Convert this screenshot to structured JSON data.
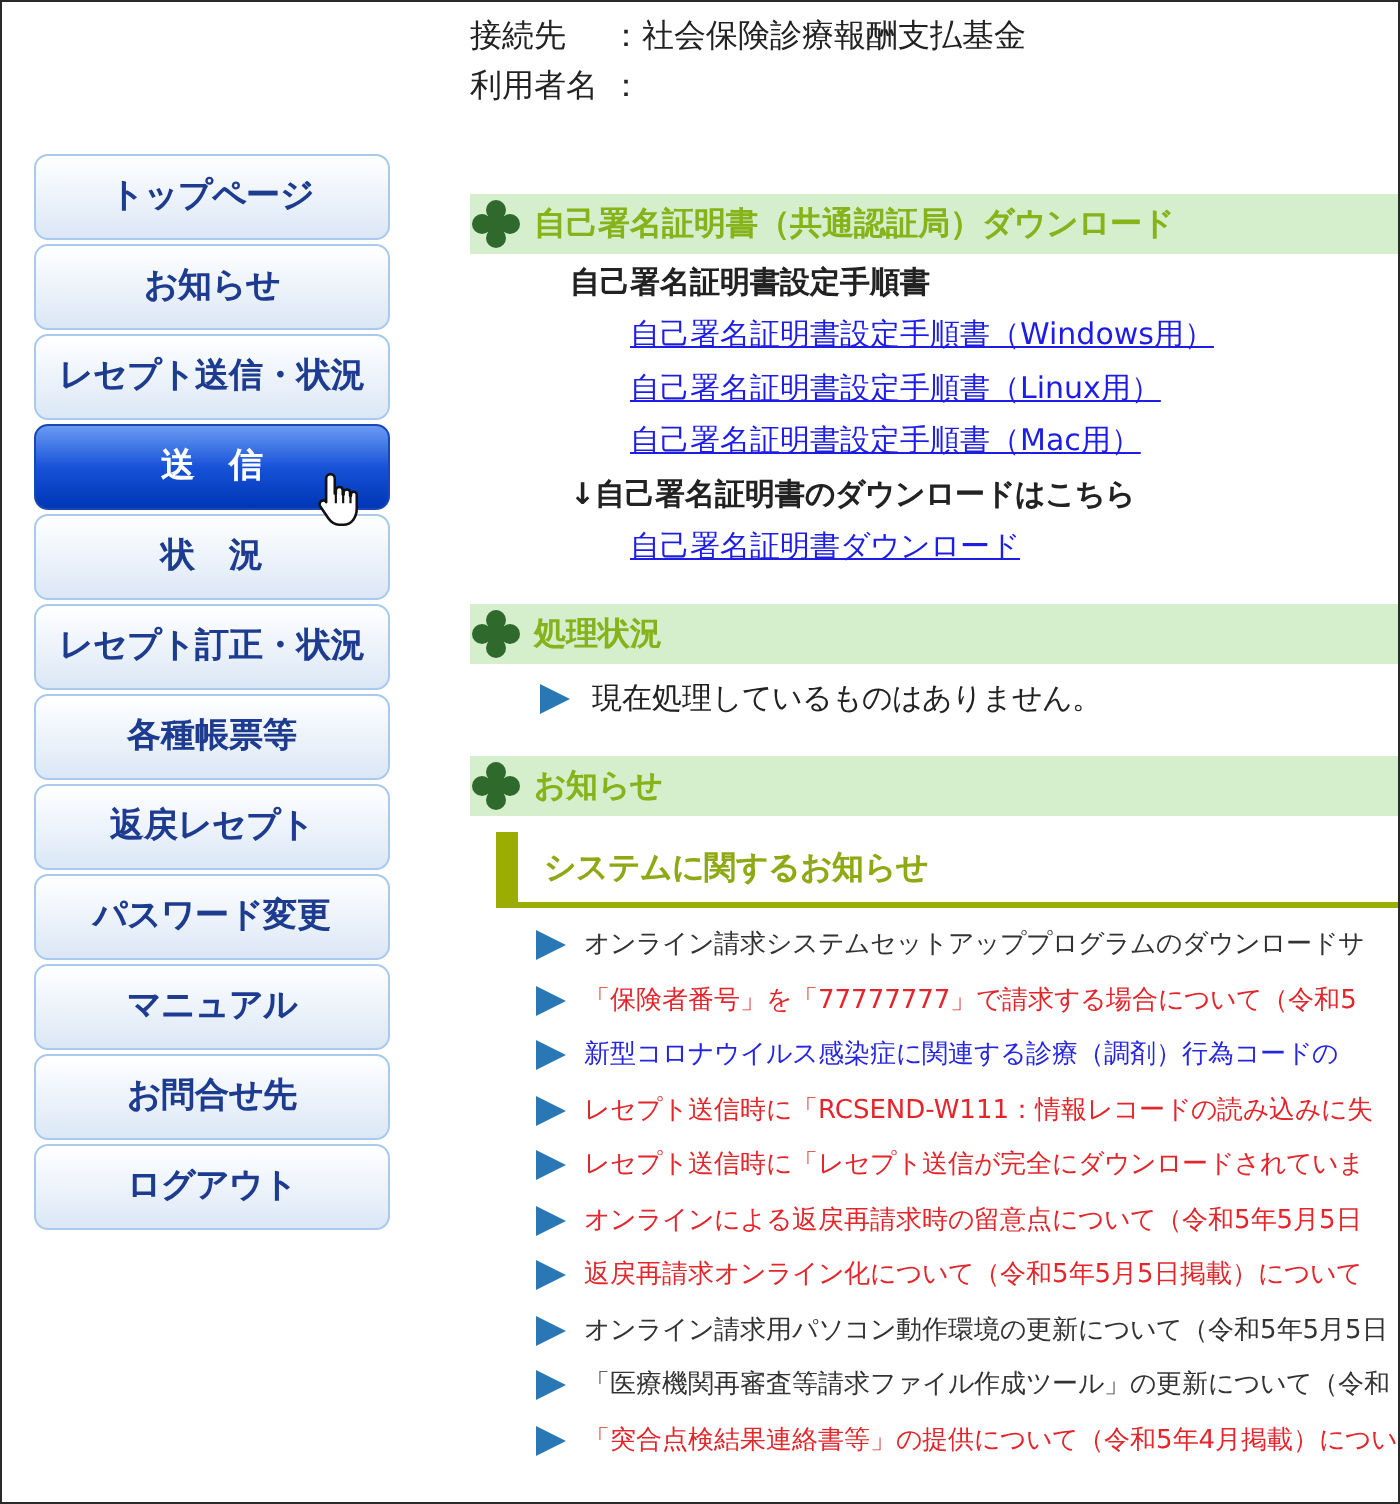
{
  "header": [
    {
      "label": "接続先",
      "colon": "：",
      "value": "社会保険診療報酬支払基金"
    },
    {
      "label": "利用者名",
      "colon": "："
    }
  ],
  "sidebar": {
    "items": [
      {
        "label": "トップページ",
        "selected": false
      },
      {
        "label": "お知らせ",
        "selected": false
      },
      {
        "label": "レセプト送信・状況",
        "selected": false
      },
      {
        "label": "送　信",
        "selected": true
      },
      {
        "label": "状　況",
        "selected": false
      },
      {
        "label": "レセプト訂正・状況",
        "selected": false
      },
      {
        "label": "各種帳票等",
        "selected": false
      },
      {
        "label": "返戻レセプト",
        "selected": false
      },
      {
        "label": "パスワード変更",
        "selected": false
      },
      {
        "label": "マニュアル",
        "selected": false
      },
      {
        "label": "お問合せ先",
        "selected": false
      },
      {
        "label": "ログアウト",
        "selected": false
      }
    ]
  },
  "sections": [
    {
      "kind": "downloads",
      "title": "自己署名証明書（共通認証局）ダウンロード",
      "groups": [
        {
          "heading": "自己署名証明書設定手順書",
          "links": [
            "自己署名証明書設定手順書（Windows用）",
            "自己署名証明書設定手順書（Linux用）",
            "自己署名証明書設定手順書（Mac用）"
          ]
        },
        {
          "heading": "↓自己署名証明書のダウンロードはこちら",
          "links": [
            "自己署名証明書ダウンロード"
          ]
        }
      ]
    },
    {
      "kind": "status",
      "title": "処理状況",
      "items": [
        "現在処理しているものはありません。"
      ]
    },
    {
      "kind": "notices",
      "title": "お知らせ",
      "subsections": [
        {
          "title": "システムに関するお知らせ",
          "items": [
            {
              "text": "オンライン請求システムセットアッププログラムのダウンロードサ",
              "color": "#333333"
            },
            {
              "text": "「保険者番号」を「77777777」で請求する場合について（令和5",
              "color": "#e3262b"
            },
            {
              "text": "新型コロナウイルス感染症に関連する診療（調剤）行為コードの",
              "color": "#2626e0"
            },
            {
              "text": "レセプト送信時に「RCSEND-W111：情報レコードの読み込みに失",
              "color": "#e3262b"
            },
            {
              "text": "レセプト送信時に「レセプト送信が完全にダウンロードされていま",
              "color": "#e3262b"
            },
            {
              "text": "オンラインによる返戻再請求時の留意点について（令和5年5月5日",
              "color": "#e3262b"
            },
            {
              "text": "返戻再請求オンライン化について（令和5年5月5日掲載）について",
              "color": "#e3262b"
            },
            {
              "text": "オンライン請求用パソコン動作環境の更新について（令和5年5月5日",
              "color": "#333333"
            },
            {
              "text": "「医療機関再審査等請求ファイル作成ツール」の更新について（令和",
              "color": "#333333"
            },
            {
              "text": "「突合点検結果連絡書等」の提供について（令和5年4月掲載）につい",
              "color": "#e3262b"
            }
          ]
        }
      ]
    }
  ]
}
